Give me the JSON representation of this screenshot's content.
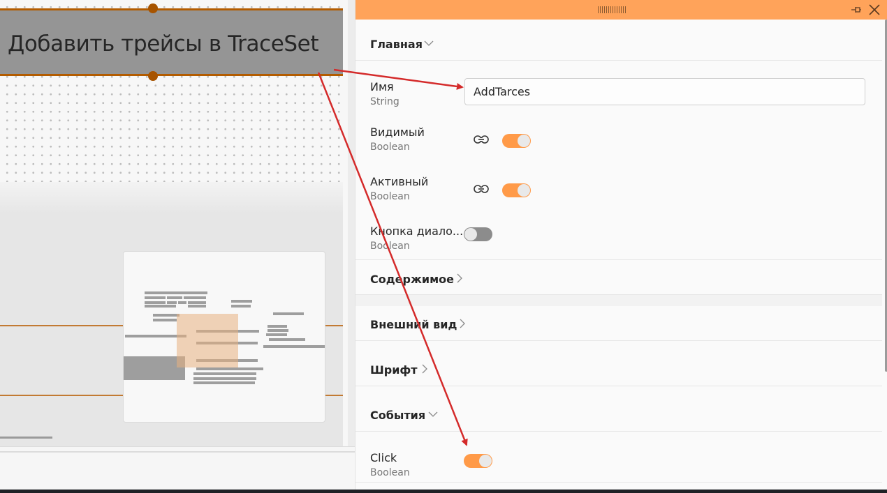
{
  "canvas": {
    "selected_button_text": "Добавить трейсы в TraceSet"
  },
  "panel": {
    "sections": {
      "main": "Главная",
      "content": "Содержимое",
      "appearance": "Внешний вид",
      "font": "Шрифт",
      "events": "События"
    },
    "properties": {
      "name": {
        "label": "Имя",
        "type": "String",
        "value": "AddTarces"
      },
      "visible": {
        "label": "Видимый",
        "type": "Boolean",
        "enabled": true
      },
      "active": {
        "label": "Активный",
        "type": "Boolean",
        "enabled": true
      },
      "dialog_button": {
        "label": "Кнопка диало...",
        "type": "Boolean",
        "enabled": false
      },
      "click": {
        "label": "Click",
        "type": "Boolean",
        "enabled": true
      }
    }
  },
  "colors": {
    "accent": "#ff9a48",
    "selection_border": "#b35c00",
    "annotation_arrow": "#d42a2a"
  }
}
